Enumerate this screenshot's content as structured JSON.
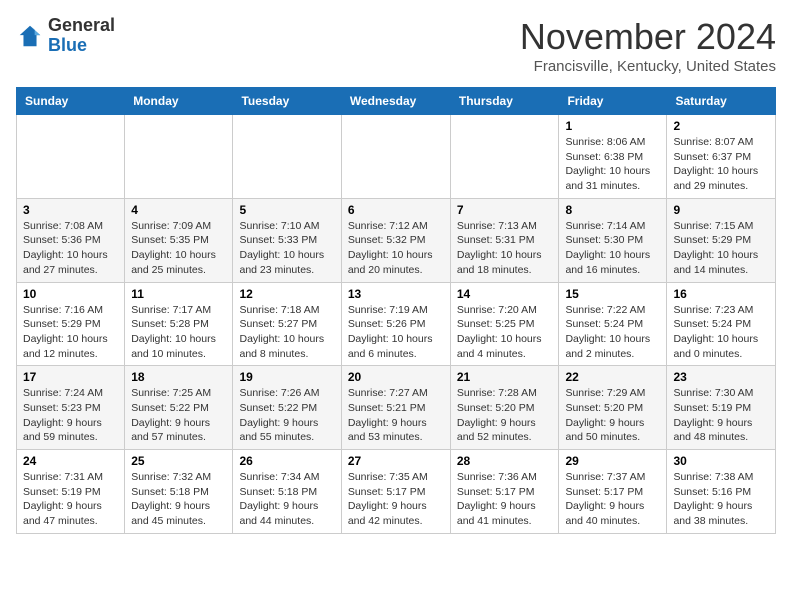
{
  "header": {
    "logo_general": "General",
    "logo_blue": "Blue",
    "month": "November 2024",
    "location": "Francisville, Kentucky, United States"
  },
  "days_of_week": [
    "Sunday",
    "Monday",
    "Tuesday",
    "Wednesday",
    "Thursday",
    "Friday",
    "Saturday"
  ],
  "weeks": [
    [
      {
        "day": "",
        "info": ""
      },
      {
        "day": "",
        "info": ""
      },
      {
        "day": "",
        "info": ""
      },
      {
        "day": "",
        "info": ""
      },
      {
        "day": "",
        "info": ""
      },
      {
        "day": "1",
        "info": "Sunrise: 8:06 AM\nSunset: 6:38 PM\nDaylight: 10 hours and 31 minutes."
      },
      {
        "day": "2",
        "info": "Sunrise: 8:07 AM\nSunset: 6:37 PM\nDaylight: 10 hours and 29 minutes."
      }
    ],
    [
      {
        "day": "3",
        "info": "Sunrise: 7:08 AM\nSunset: 5:36 PM\nDaylight: 10 hours and 27 minutes."
      },
      {
        "day": "4",
        "info": "Sunrise: 7:09 AM\nSunset: 5:35 PM\nDaylight: 10 hours and 25 minutes."
      },
      {
        "day": "5",
        "info": "Sunrise: 7:10 AM\nSunset: 5:33 PM\nDaylight: 10 hours and 23 minutes."
      },
      {
        "day": "6",
        "info": "Sunrise: 7:12 AM\nSunset: 5:32 PM\nDaylight: 10 hours and 20 minutes."
      },
      {
        "day": "7",
        "info": "Sunrise: 7:13 AM\nSunset: 5:31 PM\nDaylight: 10 hours and 18 minutes."
      },
      {
        "day": "8",
        "info": "Sunrise: 7:14 AM\nSunset: 5:30 PM\nDaylight: 10 hours and 16 minutes."
      },
      {
        "day": "9",
        "info": "Sunrise: 7:15 AM\nSunset: 5:29 PM\nDaylight: 10 hours and 14 minutes."
      }
    ],
    [
      {
        "day": "10",
        "info": "Sunrise: 7:16 AM\nSunset: 5:29 PM\nDaylight: 10 hours and 12 minutes."
      },
      {
        "day": "11",
        "info": "Sunrise: 7:17 AM\nSunset: 5:28 PM\nDaylight: 10 hours and 10 minutes."
      },
      {
        "day": "12",
        "info": "Sunrise: 7:18 AM\nSunset: 5:27 PM\nDaylight: 10 hours and 8 minutes."
      },
      {
        "day": "13",
        "info": "Sunrise: 7:19 AM\nSunset: 5:26 PM\nDaylight: 10 hours and 6 minutes."
      },
      {
        "day": "14",
        "info": "Sunrise: 7:20 AM\nSunset: 5:25 PM\nDaylight: 10 hours and 4 minutes."
      },
      {
        "day": "15",
        "info": "Sunrise: 7:22 AM\nSunset: 5:24 PM\nDaylight: 10 hours and 2 minutes."
      },
      {
        "day": "16",
        "info": "Sunrise: 7:23 AM\nSunset: 5:24 PM\nDaylight: 10 hours and 0 minutes."
      }
    ],
    [
      {
        "day": "17",
        "info": "Sunrise: 7:24 AM\nSunset: 5:23 PM\nDaylight: 9 hours and 59 minutes."
      },
      {
        "day": "18",
        "info": "Sunrise: 7:25 AM\nSunset: 5:22 PM\nDaylight: 9 hours and 57 minutes."
      },
      {
        "day": "19",
        "info": "Sunrise: 7:26 AM\nSunset: 5:22 PM\nDaylight: 9 hours and 55 minutes."
      },
      {
        "day": "20",
        "info": "Sunrise: 7:27 AM\nSunset: 5:21 PM\nDaylight: 9 hours and 53 minutes."
      },
      {
        "day": "21",
        "info": "Sunrise: 7:28 AM\nSunset: 5:20 PM\nDaylight: 9 hours and 52 minutes."
      },
      {
        "day": "22",
        "info": "Sunrise: 7:29 AM\nSunset: 5:20 PM\nDaylight: 9 hours and 50 minutes."
      },
      {
        "day": "23",
        "info": "Sunrise: 7:30 AM\nSunset: 5:19 PM\nDaylight: 9 hours and 48 minutes."
      }
    ],
    [
      {
        "day": "24",
        "info": "Sunrise: 7:31 AM\nSunset: 5:19 PM\nDaylight: 9 hours and 47 minutes."
      },
      {
        "day": "25",
        "info": "Sunrise: 7:32 AM\nSunset: 5:18 PM\nDaylight: 9 hours and 45 minutes."
      },
      {
        "day": "26",
        "info": "Sunrise: 7:34 AM\nSunset: 5:18 PM\nDaylight: 9 hours and 44 minutes."
      },
      {
        "day": "27",
        "info": "Sunrise: 7:35 AM\nSunset: 5:17 PM\nDaylight: 9 hours and 42 minutes."
      },
      {
        "day": "28",
        "info": "Sunrise: 7:36 AM\nSunset: 5:17 PM\nDaylight: 9 hours and 41 minutes."
      },
      {
        "day": "29",
        "info": "Sunrise: 7:37 AM\nSunset: 5:17 PM\nDaylight: 9 hours and 40 minutes."
      },
      {
        "day": "30",
        "info": "Sunrise: 7:38 AM\nSunset: 5:16 PM\nDaylight: 9 hours and 38 minutes."
      }
    ]
  ]
}
